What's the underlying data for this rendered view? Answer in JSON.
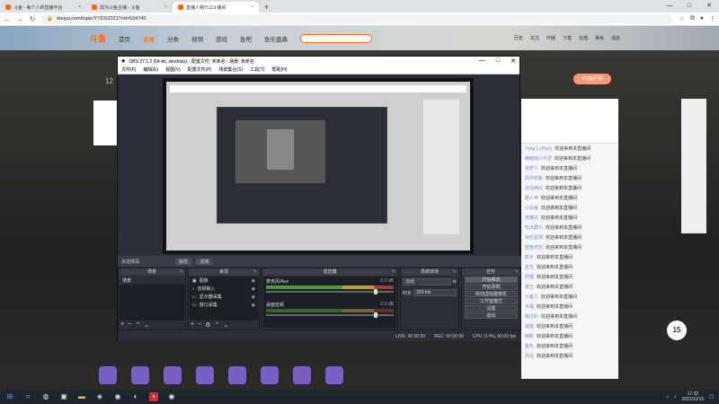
{
  "browser": {
    "tabs": [
      {
        "label": "斗鱼 - 每个人的直播平台",
        "active": false
      },
      {
        "label": "成为斗鱼主播 - 斗鱼",
        "active": false
      },
      {
        "label": "直播人物YLS斗播间",
        "active": true
      }
    ],
    "url": "douyu.com/topic/YYDS2021?rid=534740"
  },
  "douyu": {
    "logo": "斗鱼",
    "nav": [
      "首页",
      "直播",
      "分类",
      "视频",
      "游戏",
      "鱼吧",
      "鱼乐盛典"
    ],
    "header_icons": [
      "历史",
      "关注",
      "开播",
      "下载",
      "充值",
      "等级",
      "消息"
    ],
    "left_number": "12",
    "gift_button": "PC客户端",
    "badge": "15"
  },
  "obs": {
    "title": "OBS 27.1.2 (64-bit, windows) - 配置文件: 未命名 - 场景: 未命名",
    "menu": [
      "文件(F)",
      "编辑(E)",
      "视图(V)",
      "配置文件(P)",
      "场景集合(S)",
      "工具(T)",
      "帮助(H)"
    ],
    "source_bar": {
      "label": "未选择源",
      "btn_props": "属性",
      "btn_filters": "滤镜"
    },
    "docks": {
      "scenes": {
        "title": "场景",
        "items": [
          "场景"
        ]
      },
      "sources": {
        "title": "来源",
        "items": [
          "图像",
          "音频输入",
          "显示器采集",
          "窗口采集"
        ]
      },
      "mixer": {
        "title": "混音器",
        "channels": [
          {
            "name": "麦克风/Aux",
            "db": "0.0 dB"
          },
          {
            "name": "桌面音频",
            "db": "0.0 dB"
          }
        ]
      },
      "transitions": {
        "title": "场景转场",
        "type": "淡出",
        "duration_label": "时长",
        "duration": "300 ms"
      },
      "controls": {
        "title": "控件",
        "buttons": [
          "开始推流",
          "开始录制",
          "启动虚拟摄像机",
          "工作室模式",
          "设置",
          "退出"
        ]
      }
    },
    "status": {
      "live": "LIVE: 00:00:00",
      "rec": "REC: 00:00:00",
      "cpu": "CPU: 0.4%, 60.00 fps"
    }
  },
  "chat": {
    "lines": [
      {
        "name": "Yang L.(Piao)",
        "msg": "欢迎来到本直播间"
      },
      {
        "name": "萌萌哒小可爱",
        "msg": "欢迎来到本直播间"
      },
      {
        "name": "追梦人",
        "msg": "欢迎来到本直播间"
      },
      {
        "name": "风中的鱼",
        "msg": "欢迎来到本直播间"
      },
      {
        "name": "冰冻西瓜",
        "msg": "欢迎来到本直播间"
      },
      {
        "name": "路人甲",
        "msg": "欢迎来到本直播间"
      },
      {
        "name": "小白兔",
        "msg": "欢迎来到本直播间"
      },
      {
        "name": "夜猫子",
        "msg": "欢迎来到本直播间"
      },
      {
        "name": "吃瓜群众",
        "msg": "欢迎来到本直播间"
      },
      {
        "name": "快乐星球",
        "msg": "欢迎来到本直播间"
      },
      {
        "name": "蓝色天空",
        "msg": "欢迎来到本直播间"
      },
      {
        "name": "影子",
        "msg": "欢迎来到本直播间"
      },
      {
        "name": "星光",
        "msg": "欢迎来到本直播间"
      },
      {
        "name": "阿狸",
        "msg": "欢迎来到本直播间"
      },
      {
        "name": "老王",
        "msg": "欢迎来到本直播间"
      },
      {
        "name": "小鱼儿",
        "msg": "欢迎来到本直播间"
      },
      {
        "name": "大橘",
        "msg": "欢迎来到本直播间"
      },
      {
        "name": "路过的",
        "msg": "欢迎来到本直播间"
      },
      {
        "name": "咸鱼",
        "msg": "欢迎来到本直播间"
      },
      {
        "name": "萌新",
        "msg": "欢迎来到本直播间"
      },
      {
        "name": "鱼丸",
        "msg": "欢迎来到本直播间"
      },
      {
        "name": "月光",
        "msg": "欢迎来到本直播间"
      }
    ]
  },
  "taskbar": {
    "time": "17:32",
    "date": "2021/11/15"
  }
}
